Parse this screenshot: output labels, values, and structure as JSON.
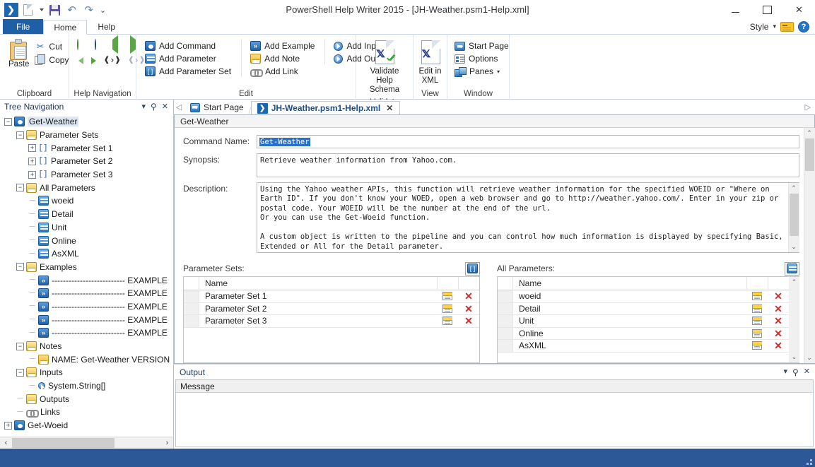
{
  "window": {
    "title": "PowerShell Help Writer 2015 - [JH-Weather.psm1-Help.xml]",
    "minimize_label": "",
    "maximize_label": "",
    "close_label": "✕"
  },
  "quick_access": {
    "app_icon": "app-logo-icon",
    "new_label": "new-document-icon",
    "new_dropdown": "chevron-down-icon",
    "save_label": "save-icon",
    "undo_label": "↶",
    "redo_label": "↷",
    "customize_label": "⌄"
  },
  "ribbon": {
    "tabs": [
      {
        "label": "File",
        "active": false,
        "file": true
      },
      {
        "label": "Home",
        "active": true,
        "file": false
      },
      {
        "label": "Help",
        "active": false,
        "file": false
      }
    ],
    "style_label": "Style",
    "style_caret": "▾",
    "groups": [
      {
        "name": "Clipboard",
        "big_button": {
          "label": "Paste",
          "icon": "paste-icon"
        },
        "items": [
          {
            "label": "Cut",
            "icon": "cut-icon"
          },
          {
            "label": "Copy",
            "icon": "copy-icon"
          }
        ]
      },
      {
        "name": "Help Navigation",
        "items": []
      },
      {
        "name": "Edit",
        "col1": [
          {
            "label": "Add Command",
            "icon": "add-command-icon"
          },
          {
            "label": "Add Parameter",
            "icon": "add-parameter-icon"
          },
          {
            "label": "Add Parameter Set",
            "icon": "add-parameter-set-icon"
          }
        ],
        "col2": [
          {
            "label": "Add Example",
            "icon": "add-example-icon"
          },
          {
            "label": "Add Note",
            "icon": "add-note-icon"
          },
          {
            "label": "Add Link",
            "icon": "add-link-icon"
          }
        ],
        "col3": [
          {
            "label": "Add Input",
            "icon": "add-input-icon"
          },
          {
            "label": "Add Output",
            "icon": "add-output-icon"
          }
        ]
      },
      {
        "name": "Validate",
        "big_button": {
          "label": "Validate\nHelp Schema",
          "line1": "Validate",
          "line2": "Help Schema",
          "icon": "validate-xml-icon"
        }
      },
      {
        "name": "View",
        "big_button": {
          "line1": "Edit in",
          "line2": "XML",
          "icon": "edit-xml-icon"
        }
      },
      {
        "name": "Window",
        "items": [
          {
            "label": "Start Page",
            "icon": "start-page-icon"
          },
          {
            "label": "Options",
            "icon": "options-icon"
          },
          {
            "label": "Panes",
            "icon": "panes-icon",
            "caret": "▾"
          }
        ]
      }
    ]
  },
  "tree_pane": {
    "title": "Tree Navigation",
    "dropdown_glyph": "▾",
    "pin_glyph": "⚲",
    "close_glyph": "✕",
    "nodes": [
      {
        "depth": 0,
        "expander": "−",
        "icon": "command-icon",
        "label": "Get-Weather",
        "selected": true
      },
      {
        "depth": 1,
        "expander": "−",
        "icon": "folder-icon",
        "label": "Parameter Sets",
        "selected": false
      },
      {
        "depth": 2,
        "expander": "+",
        "icon": "parameter-set-icon",
        "label": "Parameter Set 1",
        "selected": false
      },
      {
        "depth": 2,
        "expander": "+",
        "icon": "parameter-set-icon",
        "label": "Parameter Set 2",
        "selected": false
      },
      {
        "depth": 2,
        "expander": "+",
        "icon": "parameter-set-icon",
        "label": "Parameter Set 3",
        "selected": false
      },
      {
        "depth": 1,
        "expander": "−",
        "icon": "folder-icon",
        "label": "All Parameters",
        "selected": false
      },
      {
        "depth": 2,
        "expander": "",
        "icon": "parameter-icon",
        "label": "woeid",
        "selected": false
      },
      {
        "depth": 2,
        "expander": "",
        "icon": "parameter-icon",
        "label": "Detail",
        "selected": false
      },
      {
        "depth": 2,
        "expander": "",
        "icon": "parameter-icon",
        "label": "Unit",
        "selected": false
      },
      {
        "depth": 2,
        "expander": "",
        "icon": "parameter-icon",
        "label": "Online",
        "selected": false
      },
      {
        "depth": 2,
        "expander": "",
        "icon": "parameter-icon",
        "label": "AsXML",
        "selected": false
      },
      {
        "depth": 1,
        "expander": "−",
        "icon": "folder-icon",
        "label": "Examples",
        "selected": false
      },
      {
        "depth": 2,
        "expander": "",
        "icon": "example-icon",
        "label": "-------------------------- EXAMPLE",
        "selected": false
      },
      {
        "depth": 2,
        "expander": "",
        "icon": "example-icon",
        "label": "-------------------------- EXAMPLE",
        "selected": false
      },
      {
        "depth": 2,
        "expander": "",
        "icon": "example-icon",
        "label": "-------------------------- EXAMPLE",
        "selected": false
      },
      {
        "depth": 2,
        "expander": "",
        "icon": "example-icon",
        "label": "-------------------------- EXAMPLE",
        "selected": false
      },
      {
        "depth": 2,
        "expander": "",
        "icon": "example-icon",
        "label": "-------------------------- EXAMPLE",
        "selected": false
      },
      {
        "depth": 1,
        "expander": "−",
        "icon": "folder-icon",
        "label": "Notes",
        "selected": false
      },
      {
        "depth": 2,
        "expander": "",
        "icon": "note-icon",
        "label": "NAME:      Get-Weather VERSION",
        "selected": false
      },
      {
        "depth": 1,
        "expander": "−",
        "icon": "folder-icon",
        "label": "Inputs",
        "selected": false
      },
      {
        "depth": 2,
        "expander": "",
        "icon": "input-icon",
        "label": "System.String[]",
        "selected": false
      },
      {
        "depth": 1,
        "expander": "",
        "icon": "folder-icon",
        "label": "Outputs",
        "selected": false
      },
      {
        "depth": 1,
        "expander": "",
        "icon": "link-icon",
        "label": "Links",
        "selected": false
      },
      {
        "depth": 0,
        "expander": "+",
        "icon": "command-icon",
        "label": "Get-Woeid",
        "selected": false
      }
    ],
    "hscroll": {
      "left_glyph": "‹",
      "right_glyph": "›"
    }
  },
  "doc_tabs": {
    "scroll_left_glyph": "◁",
    "scroll_right_glyph": "▷",
    "tabs": [
      {
        "label": "Start Page",
        "icon": "start-page-icon",
        "active": false,
        "closable": false
      },
      {
        "label": "JH-Weather.psm1-Help.xml",
        "icon": "xml-doc-icon",
        "active": true,
        "closable": true,
        "close_glyph": "✕"
      }
    ]
  },
  "editor": {
    "title": "Get-Weather",
    "fields": {
      "command_name_label": "Command Name:",
      "command_name_value": "Get-Weather",
      "synopsis_label": "Synopsis:",
      "synopsis_value": "Retrieve weather information from Yahoo.com.",
      "description_label": "Description:",
      "description_value": "Using the Yahoo weather APIs, this function will retrieve weather information for the specified WOEID or \"Where on\nEarth ID\". If you don't know your WOED, open a web browser and go to http://weather.yahoo.com/. Enter in your zip or\npostal code. Your WOEID will be the number at the end of the url.\nOr you can use the Get-Woeid function.\n\nA custom object is written to the pipeline and you can control how much information is displayed by specifying Basic,\nExtended or All for the Detail parameter.\n\nBasic properties:\n    Date,Location,Temperature,Condition,ForecastCondition,ForecastLow, and ForecastHigh. This is the default.\nExtended properties:"
    },
    "parameter_sets": {
      "label": "Parameter Sets:",
      "add_button_icon": "add-parameter-set-icon",
      "column_name": "Name",
      "rows": [
        {
          "name": "Parameter Set 1",
          "edit_icon": "edit-icon",
          "delete_glyph": "✕"
        },
        {
          "name": "Parameter Set 2",
          "edit_icon": "edit-icon",
          "delete_glyph": "✕"
        },
        {
          "name": "Parameter Set 3",
          "edit_icon": "edit-icon",
          "delete_glyph": "✕"
        }
      ]
    },
    "all_parameters": {
      "label": "All Parameters:",
      "add_button_icon": "add-parameter-icon",
      "column_name": "Name",
      "rows": [
        {
          "name": "woeid",
          "edit_icon": "edit-icon",
          "delete_glyph": "✕"
        },
        {
          "name": "Detail",
          "edit_icon": "edit-icon",
          "delete_glyph": "✕"
        },
        {
          "name": "Unit",
          "edit_icon": "edit-icon",
          "delete_glyph": "✕"
        },
        {
          "name": "Online",
          "edit_icon": "edit-icon",
          "delete_glyph": "✕"
        },
        {
          "name": "AsXML",
          "edit_icon": "edit-icon",
          "delete_glyph": "✕"
        }
      ]
    },
    "scroll_up_glyph": "⌃",
    "scroll_down_glyph": "⌄"
  },
  "output_pane": {
    "title": "Output",
    "dropdown_glyph": "▾",
    "pin_glyph": "⚲",
    "close_glyph": "✕",
    "column_message": "Message",
    "rows": []
  },
  "colors": {
    "accent_blue": "#1f5fa6",
    "status_bar": "#2c5898",
    "selection_blue": "#2a6fc9",
    "tab_active_text": "#1a4f8a",
    "delete_red": "#d22b2b"
  }
}
